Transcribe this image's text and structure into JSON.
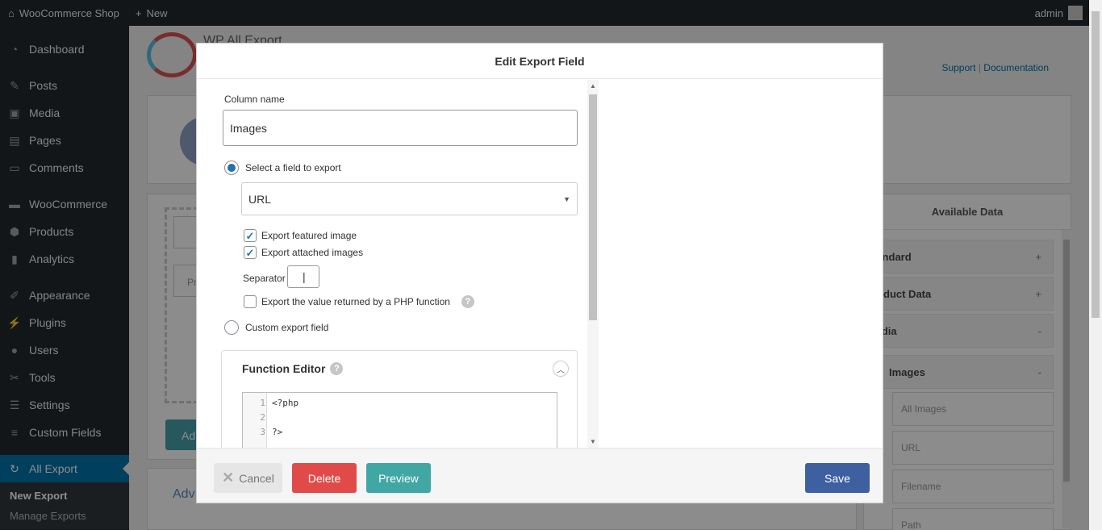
{
  "adminbar": {
    "site_name": "WooCommerce Shop",
    "new_label": "New",
    "user": "admin"
  },
  "sidebar": {
    "items": [
      {
        "label": "Dashboard",
        "icon": "dashboard-icon"
      },
      {
        "label": "Posts",
        "icon": "pin-icon"
      },
      {
        "label": "Media",
        "icon": "media-icon"
      },
      {
        "label": "Pages",
        "icon": "pages-icon"
      },
      {
        "label": "Comments",
        "icon": "comment-icon"
      },
      {
        "label": "WooCommerce",
        "icon": "woo-icon"
      },
      {
        "label": "Products",
        "icon": "box-icon"
      },
      {
        "label": "Analytics",
        "icon": "bar-chart-icon"
      },
      {
        "label": "Appearance",
        "icon": "brush-icon"
      },
      {
        "label": "Plugins",
        "icon": "plug-icon"
      },
      {
        "label": "Users",
        "icon": "user-icon"
      },
      {
        "label": "Tools",
        "icon": "wrench-icon"
      },
      {
        "label": "Settings",
        "icon": "settings-icon"
      },
      {
        "label": "Custom Fields",
        "icon": "list-icon"
      },
      {
        "label": "All Export",
        "icon": "export-icon"
      }
    ],
    "submenu": [
      {
        "label": "New Export"
      },
      {
        "label": "Manage Exports"
      }
    ]
  },
  "background": {
    "plugin_title": "WP All Export",
    "support_link": "Support",
    "link_separator": "|",
    "documentation_link": "Documentation",
    "advanced_label": "Adv",
    "add_button_label": "Ad",
    "pr_label": "Pr",
    "available_data": {
      "title": "Available Data",
      "sections": [
        {
          "label": "tandard",
          "sign": "+"
        },
        {
          "label": "roduct Data",
          "sign": "+"
        },
        {
          "label": "ledia",
          "sign": "-"
        },
        {
          "label": "Images",
          "sign": "-"
        }
      ],
      "image_fields": [
        "All Images",
        "URL",
        "Filename",
        "Path"
      ]
    }
  },
  "modal": {
    "title": "Edit Export Field",
    "column_name_label": "Column name",
    "column_name_value": "Images",
    "select_field_label": "Select a field to export",
    "selected_field": "URL",
    "export_featured_label": "Export featured image",
    "export_attached_label": "Export attached images",
    "separator_label": "Separator",
    "separator_value": "|",
    "php_function_label": "Export the value returned by a PHP function",
    "help_glyph": "?",
    "custom_field_label": "Custom export field",
    "function_editor": {
      "title": "Function Editor",
      "lines": [
        {
          "num": "1",
          "text": "<?php"
        },
        {
          "num": "2",
          "text": ""
        },
        {
          "num": "3",
          "text": "?>"
        }
      ]
    },
    "buttons": {
      "cancel": "Cancel",
      "delete": "Delete",
      "preview": "Preview",
      "save": "Save"
    }
  }
}
